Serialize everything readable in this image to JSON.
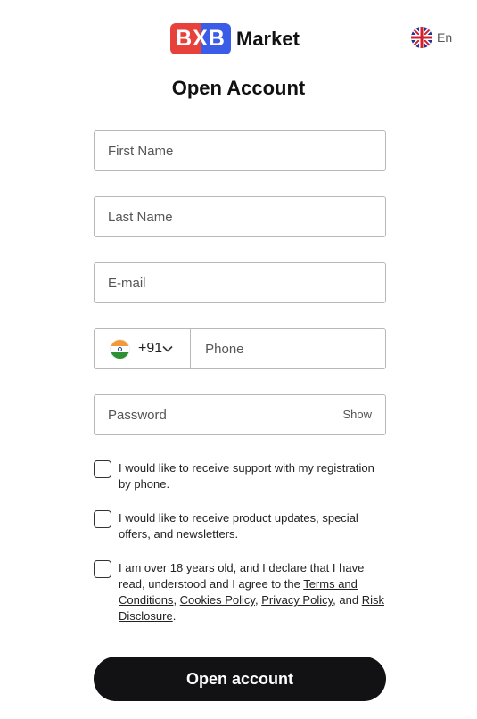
{
  "header": {
    "logo_mark": "BXB",
    "logo_word": "Market",
    "language": "En"
  },
  "title": "Open Account",
  "form": {
    "first_name_placeholder": "First Name",
    "last_name_placeholder": "Last Name",
    "email_placeholder": "E-mail",
    "country_code": "+91",
    "phone_placeholder": "Phone",
    "password_placeholder": "Password",
    "show_label": "Show"
  },
  "checkboxes": {
    "support": "I would like to receive support with my registration by phone.",
    "updates": "I would like to receive product updates, special offers, and newsletters.",
    "age_prefix": "I am over 18 years old, and I declare that I have read, understood and I agree to the ",
    "terms": "Terms and Conditions",
    "sep1": ", ",
    "cookies": "Cookies Policy",
    "sep2": ", ",
    "privacy": "Privacy Policy",
    "sep3": ", and ",
    "risk": "Risk Disclosure",
    "end": "."
  },
  "submit_label": "Open account",
  "colors": {
    "logo_red": "#e8403a",
    "logo_blue": "#3a5ce6",
    "button_bg": "#121214"
  }
}
